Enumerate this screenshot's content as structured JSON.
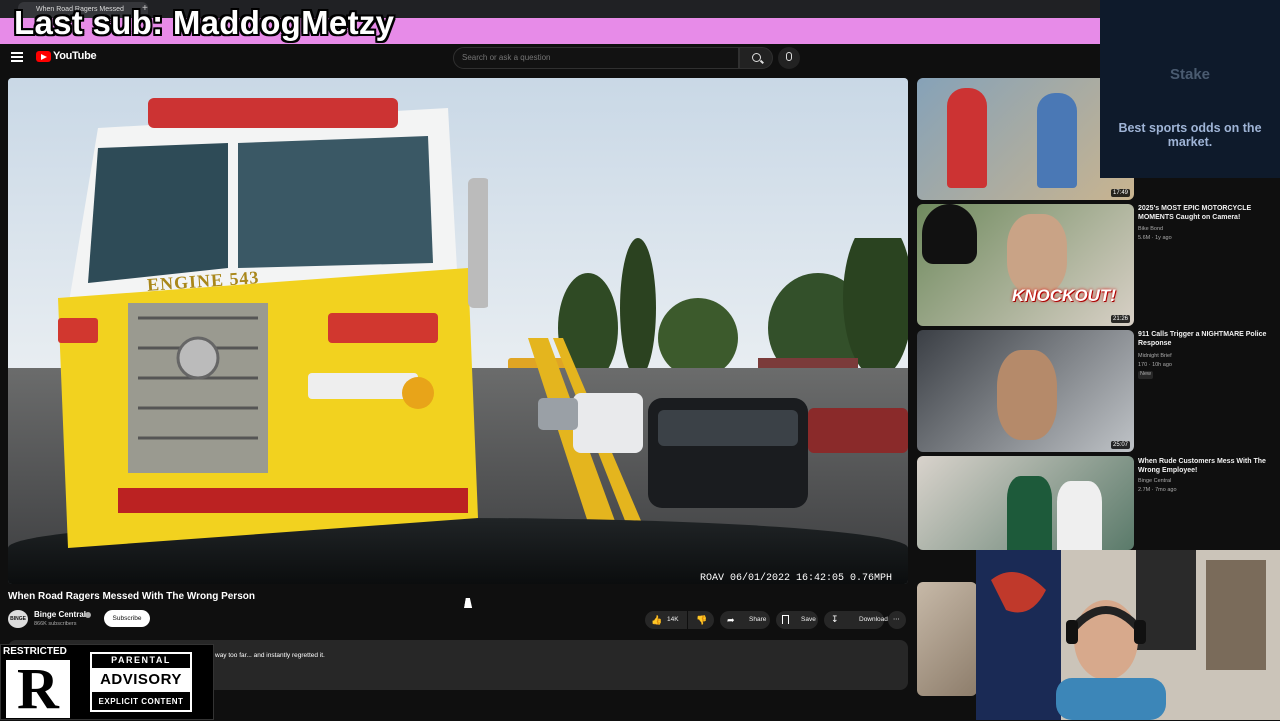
{
  "browser": {
    "tab_title": "When Road Ragers Messed",
    "new_tab_icon": "+"
  },
  "overlay": {
    "last_sub": "Last sub: MaddogMetzy"
  },
  "header": {
    "logo_text": "YouTube",
    "search_placeholder": "Search or ask a question"
  },
  "player": {
    "timestamp": "ROAV 06/01/2022 16:42:05 0.76MPH",
    "truck_label": "ENGINE 543"
  },
  "video": {
    "title": "When Road Ragers Messed With The Wrong Person",
    "channel": "Binge Central",
    "channel_avatar": "BINGE",
    "subscribers": "866K subscribers",
    "subscribe_label": "Subscribe",
    "likes": "14K",
    "share_label": "Share",
    "save_label": "Save",
    "download_label": "Download",
    "description": "way too far... and instantly regretted it."
  },
  "sidebar": [
    {
      "duration": "17:49",
      "title": "",
      "channel": "",
      "meta": ""
    },
    {
      "duration": "21:26",
      "title": "2025's MOST EPIC MOTORCYCLE MOMENTS Caught on Camera!",
      "channel": "Bike Bond",
      "meta": "5.6M · 1y ago",
      "thumb_text": "KNOCKOUT!"
    },
    {
      "duration": "25:07",
      "title": "911 Calls Trigger a NIGHTMARE Police Response",
      "channel": "Midnight Brief",
      "meta": "170 · 10h ago",
      "badge": "New"
    },
    {
      "duration": "",
      "title": "When Rude Customers Mess With The Wrong Employee!",
      "channel": "Binge Central",
      "meta": "2.7M · 7mo ago"
    }
  ],
  "ad": {
    "brand": "Stake",
    "text": "Best sports odds on the market."
  },
  "restricted": {
    "label": "RESTRICTED",
    "letter": "R",
    "pa_top": "PARENTAL",
    "pa_mid": "ADVISORY",
    "pa_bot": "EXPLICIT CONTENT"
  },
  "colors": {
    "accent": "#ff0000",
    "address_bar": "#e78be8",
    "bg": "#0f0f0f"
  }
}
